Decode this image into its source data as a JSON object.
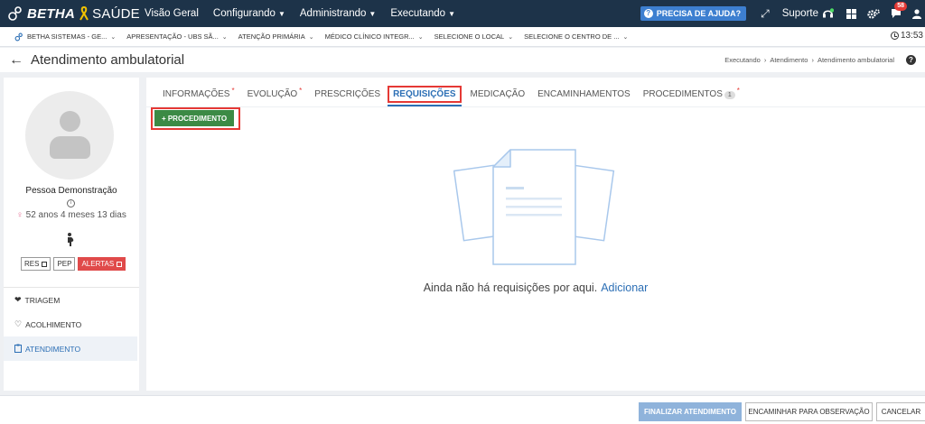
{
  "brand": {
    "name": "BETHA",
    "product": "SAÚDE"
  },
  "topnav": [
    {
      "label": "Visão Geral"
    },
    {
      "label": "Configurando"
    },
    {
      "label": "Administrando"
    },
    {
      "label": "Executando"
    }
  ],
  "topright": {
    "help_label": "PRECISA DE AJUDA?",
    "support_label": "Suporte",
    "notification_count": "58"
  },
  "context": {
    "items": [
      "BETHA SISTEMAS - GE...",
      "APRESENTAÇÃO - UBS SÃ...",
      "ATENÇÃO PRIMÁRIA",
      "MÉDICO CLÍNICO INTEGR...",
      "SELECIONE O LOCAL",
      "SELECIONE O CENTRO DE ..."
    ],
    "time": "13:53"
  },
  "page": {
    "title": "Atendimento ambulatorial",
    "breadcrumb": [
      "Executando",
      "Atendimento",
      "Atendimento ambulatorial"
    ]
  },
  "patient": {
    "name": "Pessoa Demonstração",
    "age": "52 anos 4 meses 13 dias",
    "tags": [
      "RES",
      "PEP",
      "ALERTAS"
    ]
  },
  "sidebar": {
    "items": [
      {
        "label": "TRIAGEM",
        "icon": "heartbeat-icon"
      },
      {
        "label": "ACOLHIMENTO",
        "icon": "heart-icon"
      },
      {
        "label": "ATENDIMENTO",
        "icon": "clipboard-icon",
        "active": true
      }
    ]
  },
  "tabs": [
    {
      "label": "INFORMAÇÕES",
      "required": "*"
    },
    {
      "label": "EVOLUÇÃO",
      "required": "*"
    },
    {
      "label": "PRESCRIÇÕES"
    },
    {
      "label": "REQUISIÇÕES",
      "active": true
    },
    {
      "label": "MEDICAÇÃO"
    },
    {
      "label": "ENCAMINHAMENTOS"
    },
    {
      "label": "PROCEDIMENTOS",
      "count": "1",
      "required": "*"
    }
  ],
  "main": {
    "add_procedure_label": "+ PROCEDIMENTO",
    "empty_message": "Ainda não há requisições por aqui.",
    "empty_link": "Adicionar"
  },
  "footer": {
    "finalize_label": "FINALIZAR ATENDIMENTO",
    "forward_label": "ENCAMINHAR PARA OBSERVAÇÃO",
    "cancel_label": "CANCELAR"
  },
  "colors": {
    "topbar": "#1d3349",
    "accent_blue": "#2c6fb5",
    "button_green": "#3c8a45",
    "highlight_red": "#e53935"
  }
}
